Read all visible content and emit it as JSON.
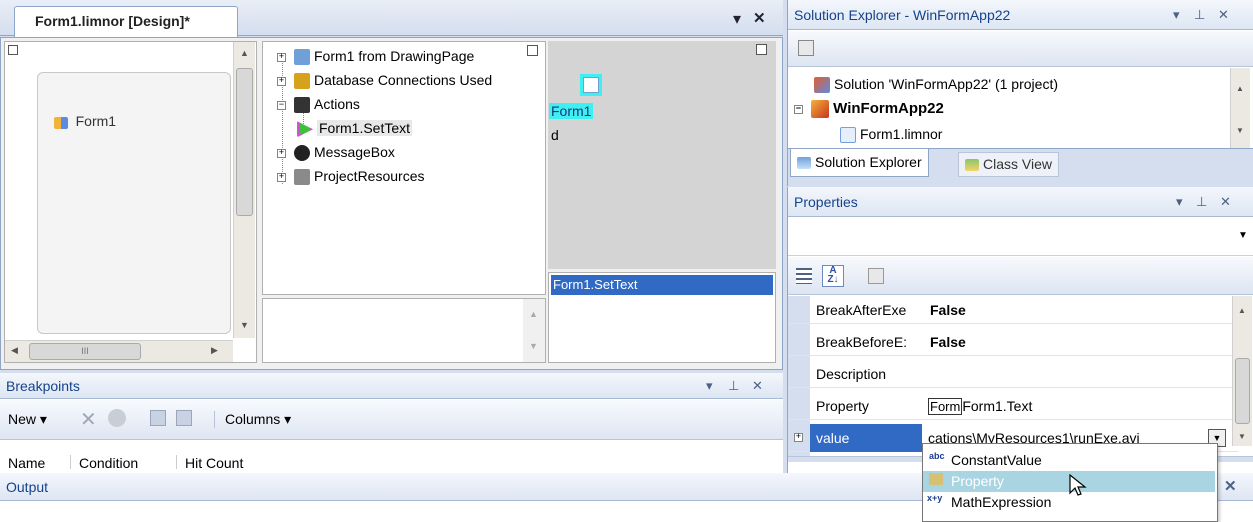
{
  "designer": {
    "tab_title": "Form1.limnor [Design]*",
    "dropdown_glyph": "▾",
    "close_glyph": "✕",
    "form_item": "Form1",
    "hscroll_ticks": "III",
    "tree": [
      {
        "label": "Form1 from DrawingPage",
        "expander": "+",
        "icon": "form-page-icon",
        "color": "#6fa0d8"
      },
      {
        "label": "Database Connections Used",
        "expander": "+",
        "icon": "database-icon",
        "color": "#d6a21c"
      },
      {
        "label": "Actions",
        "expander": "−",
        "icon": "actions-icon",
        "color": "#333"
      },
      {
        "label": "Form1.SetText",
        "expander": "",
        "icon": "action-arrow-icon",
        "color": "#3cc13c"
      },
      {
        "label": "MessageBox",
        "expander": "+",
        "icon": "info-icon",
        "color": "#222"
      },
      {
        "label": "ProjectResources",
        "expander": "+",
        "icon": "resources-icon",
        "color": "#8a8a8a"
      }
    ],
    "canvas_node_label": "Form1",
    "canvas_node_sub": "d",
    "action_list_item": "Form1.SetText"
  },
  "breakpoints": {
    "title": "Breakpoints",
    "new_label": "New",
    "columns_label": "Columns",
    "headers": [
      "Name",
      "Condition",
      "Hit Count"
    ]
  },
  "output": {
    "title": "Output"
  },
  "solution_explorer": {
    "title": "Solution Explorer - WinFormApp22",
    "items": [
      {
        "label": "Solution 'WinFormApp22' (1 project)",
        "bold": false
      },
      {
        "label": "WinFormApp22",
        "bold": true
      },
      {
        "label": "Form1.limnor",
        "bold": false
      }
    ],
    "tabs": [
      "Solution Explorer",
      "Class View"
    ]
  },
  "properties": {
    "title": "Properties",
    "rows": [
      {
        "name": "BreakAfterExe",
        "value": "False"
      },
      {
        "name": "BreakBeforeE:",
        "value": "False"
      },
      {
        "name": "Description",
        "value": ""
      },
      {
        "name": "Property",
        "value": "Form1.Text",
        "prefix": "Form"
      },
      {
        "name": "value",
        "value": "cations\\MyResources1\\runExe.avi"
      }
    ],
    "dropdown": [
      {
        "label": "ConstantValue",
        "icon_text": "abc"
      },
      {
        "label": "Property",
        "icon_text": ""
      },
      {
        "label": "MathExpression",
        "icon_text": "x+y"
      }
    ]
  },
  "colors": {
    "accent": "#316ac5",
    "selection_cyan": "#3ff0f0",
    "title_text": "#15428b"
  }
}
